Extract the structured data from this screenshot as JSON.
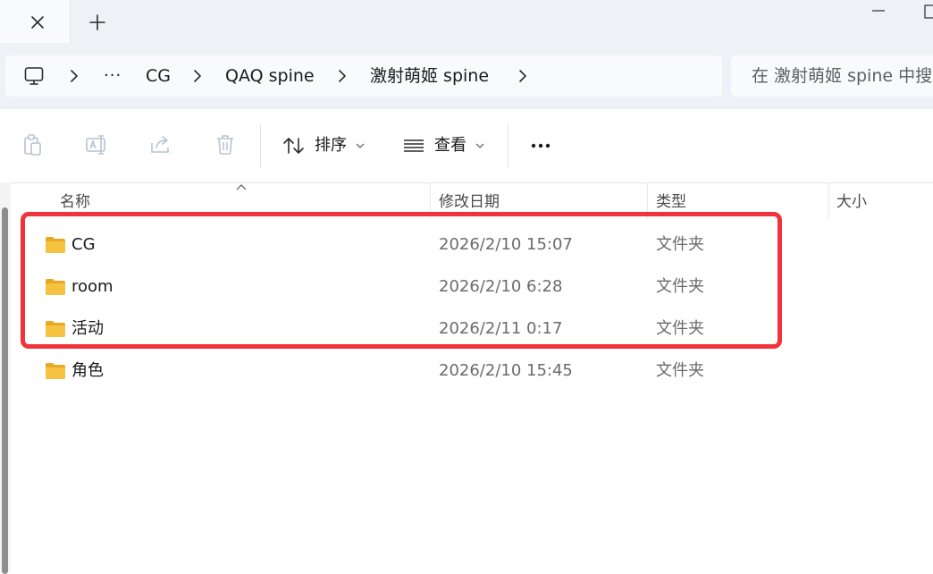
{
  "window": {
    "tab_close_icon": "close-icon",
    "new_tab_icon": "plus-icon"
  },
  "address_bar": {
    "root_icon": "this-pc-icon",
    "overflow": "···",
    "crumbs": [
      "CG",
      "QAQ spine",
      "激射萌姬 spine"
    ],
    "separator_icon": "chevron-right-icon"
  },
  "search": {
    "placeholder": "在 激射萌姬 spine 中搜"
  },
  "toolbar": {
    "icons": [
      "paste-icon",
      "rename-icon",
      "share-icon",
      "delete-icon"
    ],
    "sort_label": "排序",
    "view_label": "查看",
    "more_icon": "more-icon"
  },
  "columns": {
    "name": "名称",
    "modified": "修改日期",
    "type": "类型",
    "size": "大小"
  },
  "files": [
    {
      "name": "CG",
      "modified": "2026/2/10 15:07",
      "type": "文件夹"
    },
    {
      "name": "room",
      "modified": "2026/2/10 6:28",
      "type": "文件夹"
    },
    {
      "name": "活动",
      "modified": "2026/2/11 0:17",
      "type": "文件夹"
    },
    {
      "name": "角色",
      "modified": "2026/2/10 15:45",
      "type": "文件夹"
    }
  ],
  "colors": {
    "highlight": "#f2333b",
    "folder": "#f5c242",
    "chrome": "#eef1f6"
  }
}
